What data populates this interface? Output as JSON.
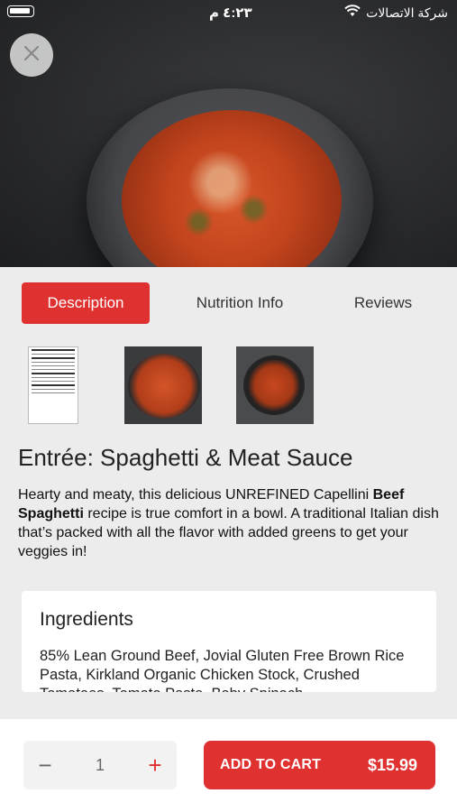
{
  "status_bar": {
    "time": "٤:٢٣ م",
    "carrier": "شركة الاتصالات"
  },
  "icons": [
    "battery-icon",
    "wifi-icon",
    "close-icon",
    "minus-icon",
    "plus-icon"
  ],
  "tabs": [
    {
      "label": "Description",
      "active": true
    },
    {
      "label": "Nutrition Info",
      "active": false
    },
    {
      "label": "Reviews",
      "active": false
    }
  ],
  "product": {
    "title": "Entrée: Spaghetti & Meat Sauce",
    "description_part1": "Hearty and meaty, this delicious UNREFINED Capellini ",
    "description_bold": "Beef Spaghetti",
    "description_part2": " recipe is true comfort in a bowl. A traditional Italian dish that’s packed with all the flavor with added greens to get your veggies in!"
  },
  "ingredients": {
    "title": "Ingredients",
    "text": "85% Lean Ground Beef, Jovial Gluten Free Brown Rice Pasta, Kirkland Organic Chicken Stock, Crushed Tomatoes, Tomato Paste, Baby Spinach"
  },
  "cart": {
    "quantity": "1",
    "minus_symbol": "−",
    "plus_symbol": "+",
    "add_label": "ADD TO CART",
    "price": "$15.99"
  },
  "colors": {
    "accent": "#e03131",
    "background": "#ececec"
  }
}
